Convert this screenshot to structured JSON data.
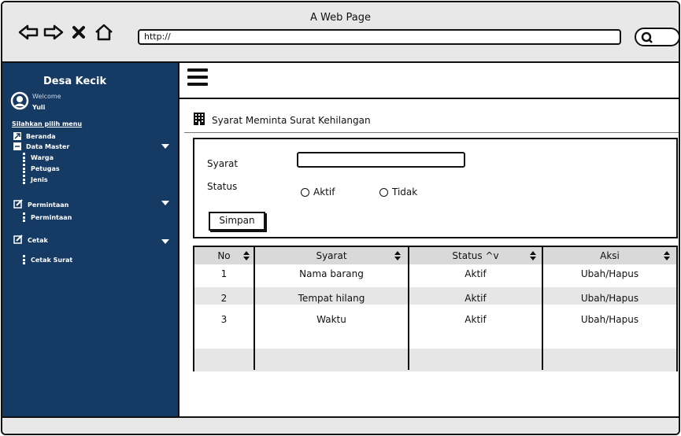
{
  "window": {
    "title": "A Web Page",
    "url": "http://"
  },
  "icons": {
    "back": "back-arrow-icon",
    "forward": "forward-arrow-icon",
    "close": "close-icon",
    "home": "home-icon",
    "search": "search-icon",
    "menu": "hamburger-menu-icon",
    "building": "building-icon"
  },
  "sidebar": {
    "title": "Desa Kecik",
    "welcome": "Welcome",
    "user": "Yuli",
    "menu_hint": "Silahkan pilih menu",
    "beranda": "Beranda",
    "data_master": "Data Master",
    "warga": "Warga",
    "petugas": "Petugas",
    "jenis": "Jenis",
    "permintaan": "Permintaan",
    "permintaan_sub": "Permintaan",
    "cetak": "Cetak",
    "cetak_surat": "Cetak Surat"
  },
  "main": {
    "heading": "Syarat Meminta Surat Kehilangan"
  },
  "form": {
    "syarat_label": "Syarat",
    "syarat_value": "",
    "status_label": "Status",
    "option_aktif": "Aktif",
    "option_tidak": "Tidak",
    "submit": "Simpan"
  },
  "table": {
    "headers": {
      "no": "No",
      "syarat": "Syarat",
      "status": "Status ^v",
      "aksi": "Aksi"
    },
    "rows": [
      {
        "no": "1",
        "syarat": "Nama barang",
        "status": "Aktif",
        "aksi": "Ubah/Hapus"
      },
      {
        "no": "2",
        "syarat": "Tempat hilang",
        "status": "Aktif",
        "aksi": "Ubah/Hapus"
      },
      {
        "no": "3",
        "syarat": "Waktu",
        "status": "Aktif",
        "aksi": "Ubah/Hapus"
      }
    ]
  },
  "colors": {
    "sidebar": "#153a63",
    "row_alt": "#e6e6e6",
    "header": "#d9d9d9"
  }
}
